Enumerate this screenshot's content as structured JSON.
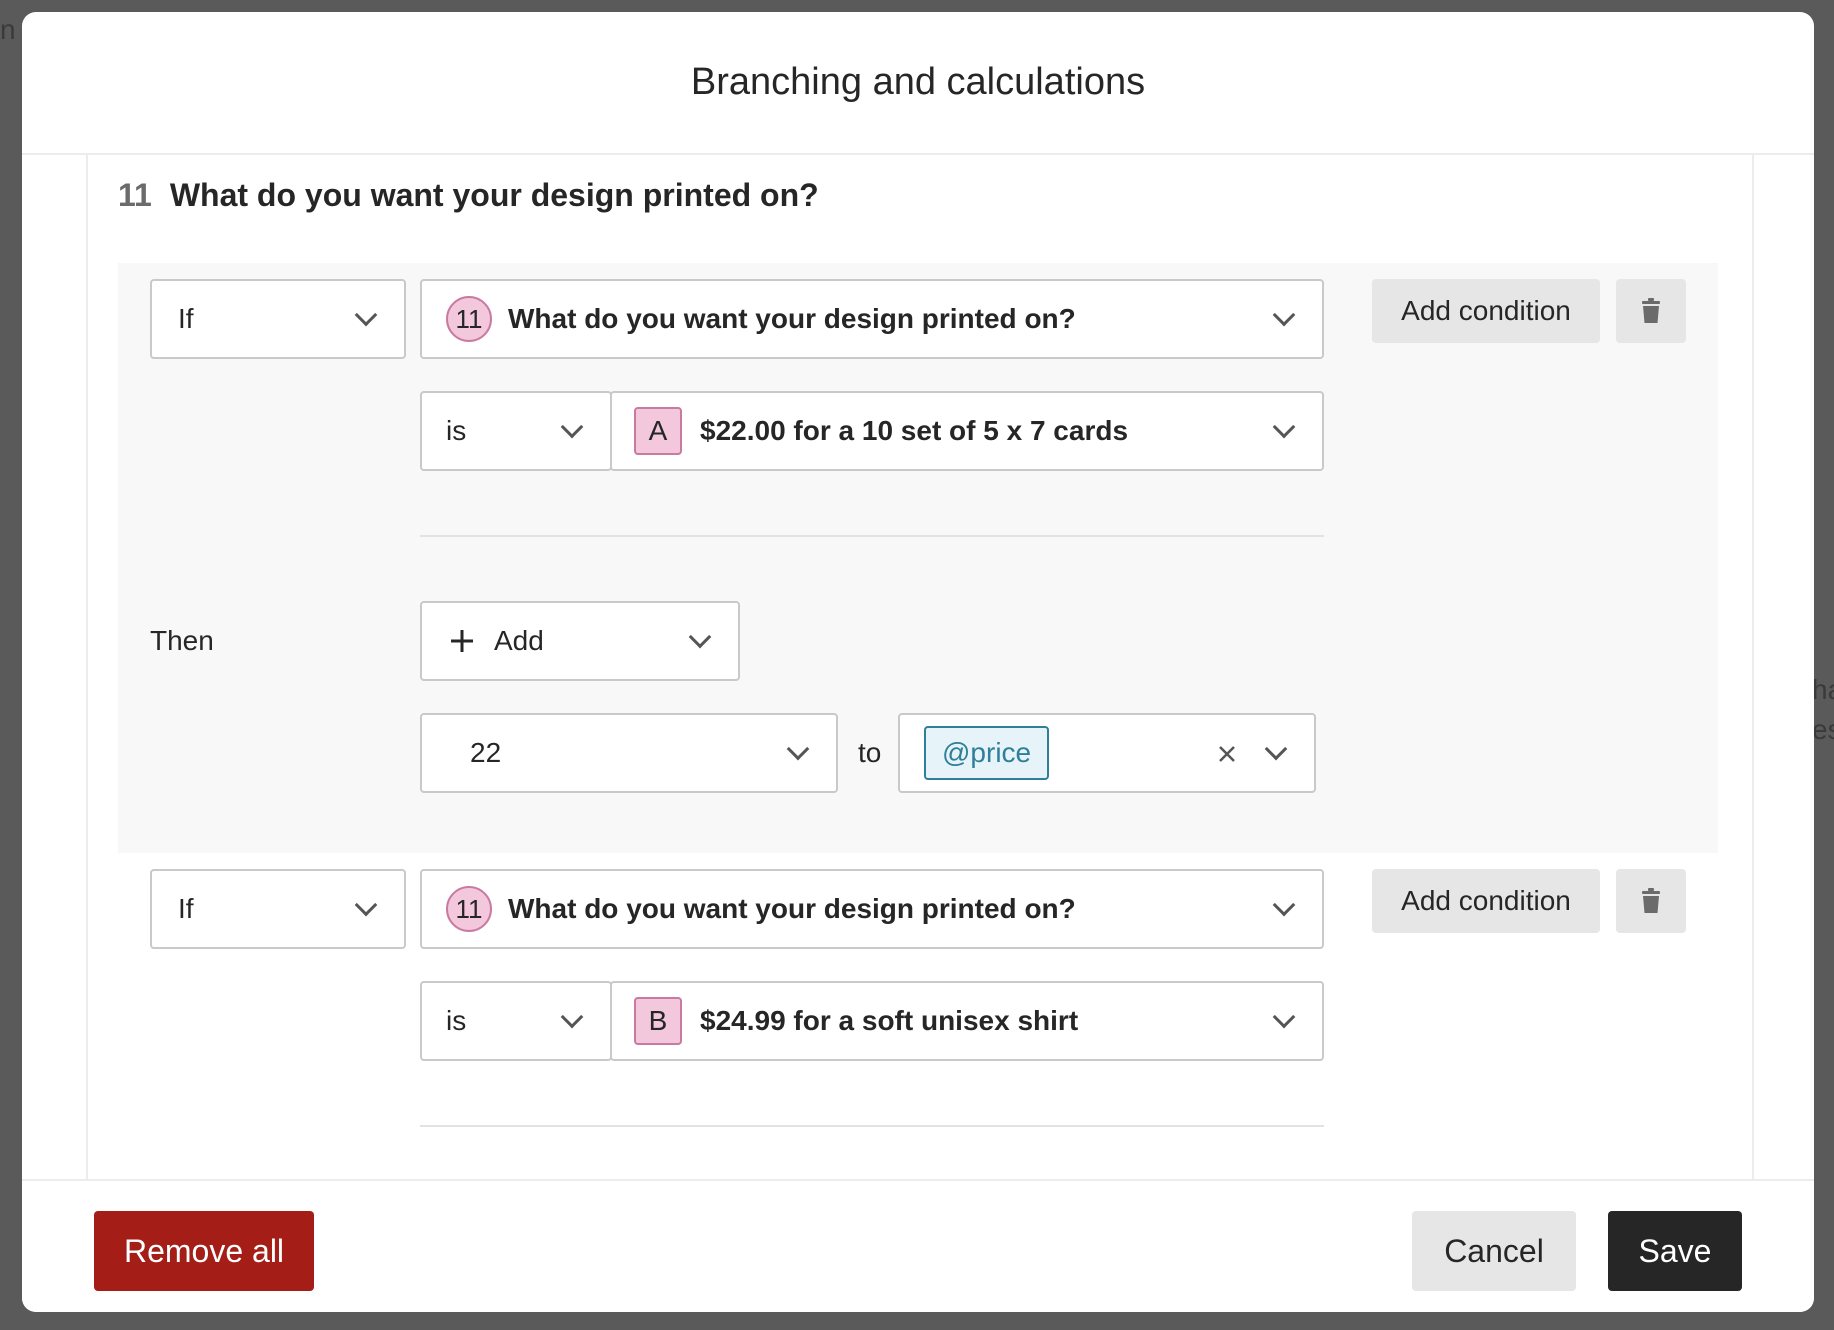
{
  "background": {
    "left_text": "n",
    "right_text_1": "ha",
    "right_text_2": "es"
  },
  "modal": {
    "title": "Branching and calculations"
  },
  "question": {
    "number": "11",
    "title": "What do you want your design printed on?"
  },
  "rules": [
    {
      "if_label": "If",
      "question_badge": "11",
      "question_text": "What do you want your design printed on?",
      "operator": "is",
      "answer_badge": "A",
      "answer_text": "$22.00 for a 10 set of 5 x 7 cards",
      "add_condition_label": "Add condition",
      "then_label": "Then",
      "add_label": "Add",
      "value": "22",
      "to_label": "to",
      "variable_tag": "@price"
    },
    {
      "if_label": "If",
      "question_badge": "11",
      "question_text": "What do you want your design printed on?",
      "operator": "is",
      "answer_badge": "B",
      "answer_text": "$24.99 for a soft unisex shirt",
      "add_condition_label": "Add condition"
    }
  ],
  "footer": {
    "remove_all": "Remove all",
    "cancel": "Cancel",
    "save": "Save"
  },
  "colors": {
    "accent_red": "#a51d17",
    "save_bg": "#262627",
    "tag_blue": "#2f7f99",
    "badge_pink": "#f3c8dc"
  }
}
